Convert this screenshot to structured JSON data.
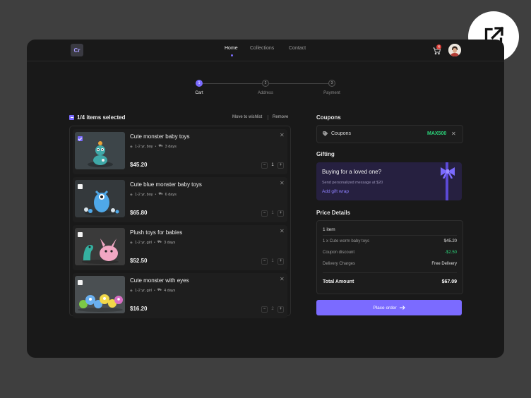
{
  "app": {
    "logo": "Cr"
  },
  "nav": {
    "home": "Home",
    "collections": "Collections",
    "contact": "Contact"
  },
  "cart_badge": "4",
  "stepper": [
    {
      "num": "1",
      "label": "Cart"
    },
    {
      "num": "2",
      "label": "Address"
    },
    {
      "num": "3",
      "label": "Payment"
    }
  ],
  "cart": {
    "selected_text": "1/4 items selected",
    "move_to_wishlist": "Move to wishlist",
    "remove": "Remove",
    "items": [
      {
        "name": "Cute monster baby toys",
        "meta": "1-2 yr, boy",
        "days": "3 days",
        "price": "$45.20",
        "qty": "1",
        "checked": true
      },
      {
        "name": "Cute blue monster baby toys",
        "meta": "1-2 yr, boy",
        "days": "6 days",
        "price": "$65.80",
        "qty": "1",
        "checked": false
      },
      {
        "name": "Plush toys for babies",
        "meta": "1-2 yr, girl",
        "days": "3 days",
        "price": "$52.50",
        "qty": "1",
        "checked": false
      },
      {
        "name": "Cute monster with eyes",
        "meta": "1-2 yr, girl",
        "days": "4 days",
        "price": "$16.20",
        "qty": "2",
        "checked": false
      }
    ]
  },
  "coupons": {
    "title": "Coupons",
    "label": "Coupons",
    "code": "MAX500"
  },
  "gifting": {
    "title": "Gifting",
    "heading": "Buying for a loved one?",
    "sub": "Send personalized message at $20",
    "link": "Add gift wrap"
  },
  "price_details": {
    "title": "Price Details",
    "count": "1 item",
    "rows": [
      {
        "label": "1 x Cute worm baby toys",
        "value": "$45.20"
      },
      {
        "label": "Coupon discount",
        "value": "-$2.50"
      },
      {
        "label": "Delivery Charges",
        "value": "Free Delivery"
      }
    ],
    "total_label": "Total Amount",
    "total_value": "$67.09"
  },
  "place_order": "Place order",
  "colors": {
    "accent": "#7b6bff",
    "success": "#2bd47a",
    "danger": "#e0413a"
  }
}
